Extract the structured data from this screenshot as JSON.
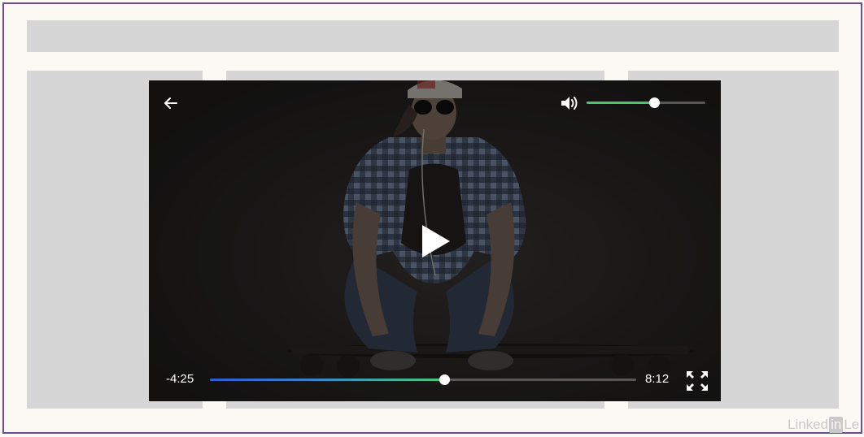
{
  "player": {
    "elapsed_time": "-4:25",
    "total_time": "8:12",
    "progress_fraction": 0.55,
    "volume_fraction": 0.57,
    "icons": {
      "back": "arrow-left-icon",
      "volume": "speaker-icon",
      "play": "play-icon",
      "fullscreen": "fullscreen-icon"
    },
    "colors": {
      "volume_fill": "#4cc66e",
      "progress_start": "#2c5ad4",
      "progress_end": "#4ac87a",
      "overlay": "#1d1b19"
    }
  },
  "watermark": {
    "prefix": "Linked",
    "in": "in",
    "suffix": "Le"
  }
}
